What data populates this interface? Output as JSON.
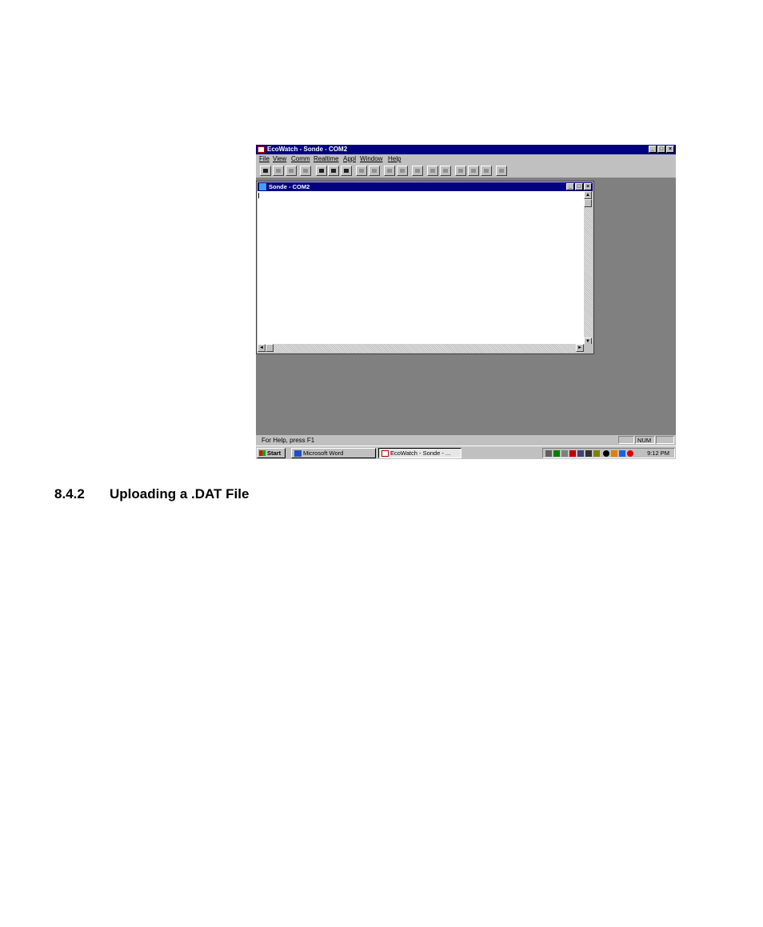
{
  "app": {
    "title": "EcoWatch - Sonde - COM2",
    "menu": [
      "File",
      "View",
      "Comm",
      "Realtime",
      "Appl",
      "Window",
      "Help"
    ],
    "window_controls": {
      "minimize": "_",
      "maximize": "□",
      "close": "×"
    },
    "toolbar_icons": [
      "open-file-icon",
      "save-icon",
      "save-as-icon",
      "properties-icon",
      "print-icon",
      "sonde-icon",
      "help-pointer-icon",
      "table-icon",
      "graph-icon",
      "report-icon",
      "info-icon",
      "plot-icon",
      "zoom-in-icon",
      "zoom-out-icon",
      "pencil-icon",
      "magnify-icon",
      "search-icon",
      "edit-icon"
    ],
    "child_window": {
      "title": "Sonde - COM2",
      "scroll_up": "▲",
      "scroll_down": "▼",
      "scroll_left": "◄",
      "scroll_right": "►"
    },
    "status": {
      "help_text": "For Help, press F1",
      "num_indicator": "NUM"
    }
  },
  "taskbar": {
    "start_label": "Start",
    "items": [
      {
        "label": "Microsoft Word",
        "active": false
      },
      {
        "label": "EcoWatch - Sonde - ...",
        "active": true
      }
    ],
    "clock": "9:12 PM"
  },
  "document": {
    "section_number": "8.4.2",
    "section_title": "Uploading a .DAT File"
  }
}
